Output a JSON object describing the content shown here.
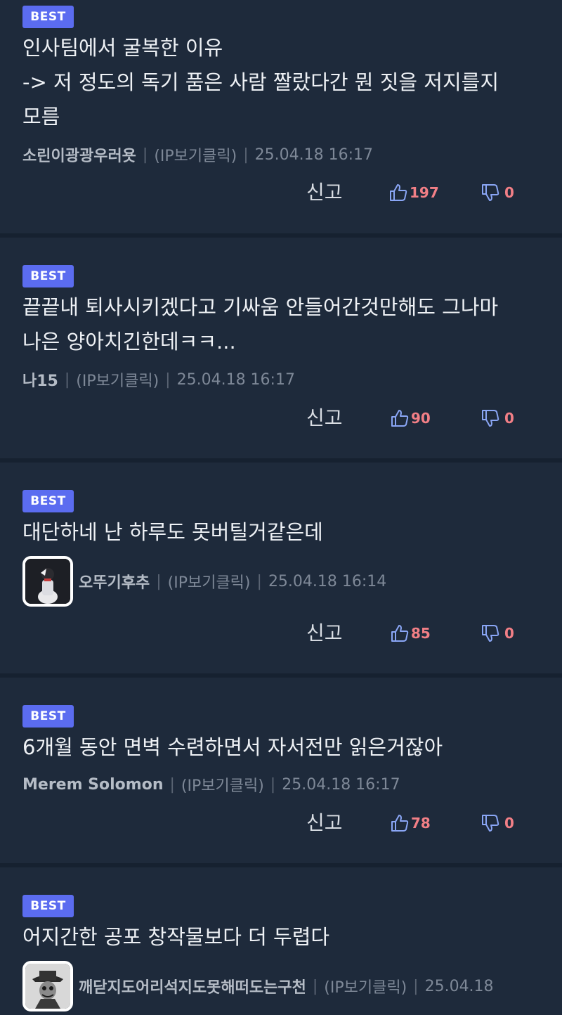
{
  "comments": [
    {
      "badge": "BEST",
      "text": "인사팀에서 굴복한 이유\n-> 저 정도의 독기 품은 사람 짤랐다간 뭔 짓을 저지를지\n모름",
      "nickname": "소린이광광우러욧",
      "ip": "(IP보기클릭)",
      "date": "25.04.18 16:17",
      "report": "신고",
      "likes": "197",
      "dislikes": "0"
    },
    {
      "badge": "BEST",
      "text": "끝끝내 퇴사시키겠다고 기싸움 안들어간것만해도 그나마\n나은 양아치긴한데ㅋㅋ...",
      "nickname": "나15",
      "ip": "(IP보기클릭)",
      "date": "25.04.18 16:17",
      "report": "신고",
      "likes": "90",
      "dislikes": "0"
    },
    {
      "badge": "BEST",
      "text": "대단하네 난 하루도 못버틸거같은데",
      "nickname": "오뚜기후추",
      "ip": "(IP보기클릭)",
      "date": "25.04.18 16:14",
      "report": "신고",
      "likes": "85",
      "dislikes": "0"
    },
    {
      "badge": "BEST",
      "text": "6개월 동안 면벽 수련하면서 자서전만 읽은거잖아",
      "nickname": "Merem Solomon",
      "ip": "(IP보기클릭)",
      "date": "25.04.18 16:17",
      "report": "신고",
      "likes": "78",
      "dislikes": "0"
    },
    {
      "badge": "BEST",
      "text": "어지간한 공포 창작물보다 더 두렵다",
      "nickname": "깨닫지도어리석지도못해떠도는구천",
      "ip": "(IP보기클릭)",
      "date": "25.04.18"
    }
  ],
  "icons": {
    "like": "thumbs-up-outline",
    "dislike": "thumbs-down-outline"
  },
  "colors": {
    "background": "#1e2a3b",
    "divider": "#162130",
    "badge": "#5b6cf0",
    "vote_count": "#f27f86",
    "thumb_icon": "#8aa6f5"
  }
}
